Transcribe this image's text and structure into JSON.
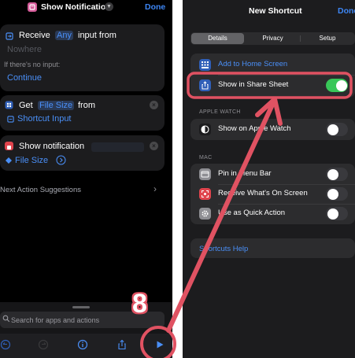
{
  "left_screen": {
    "title": "Show Notification",
    "done_label": "Done",
    "receive_action": {
      "word_receive": "Receive",
      "token_any": "Any",
      "word_input_from": "input from",
      "token_nowhere": "Nowhere",
      "no_input_label": "If there's no input:",
      "token_continue": "Continue"
    },
    "get_action": {
      "word_get": "Get",
      "token_file_size": "File Size",
      "word_from": "from",
      "token_shortcut_input": "Shortcut Input"
    },
    "notification_action": {
      "word_show_notification": "Show notification",
      "token_file_size": "File Size"
    },
    "suggestions_label": "Next Action Suggestions",
    "search": {
      "placeholder": "Search for apps and actions"
    },
    "toolbar_icons": [
      "undo-icon",
      "redo-icon",
      "info-icon",
      "share-icon",
      "play-icon"
    ]
  },
  "right_screen": {
    "title": "New Shortcut",
    "done_label": "Done",
    "tabs": [
      "Details",
      "Privacy",
      "Setup"
    ],
    "active_tab": "Details",
    "rows": {
      "add_home": "Add to Home Screen",
      "share_sheet": {
        "label": "Show in Share Sheet",
        "on": true
      }
    },
    "apple_watch_header": "APPLE WATCH",
    "watch_row": {
      "label": "Show on Apple Watch",
      "on": false
    },
    "mac_header": "MAC",
    "mac_rows": [
      {
        "label": "Pin in Menu Bar",
        "on": false
      },
      {
        "label": "Receive What's On Screen",
        "on": false
      },
      {
        "label": "Use as Quick Action",
        "on": false
      }
    ],
    "help_link": "Shortcuts Help"
  },
  "annotation": {
    "step_number": "8",
    "color": "#e05262"
  },
  "colors": {
    "accent_blue": "#3d86f5",
    "toggle_on": "#38c758",
    "app_icon": "#d65c9a"
  }
}
